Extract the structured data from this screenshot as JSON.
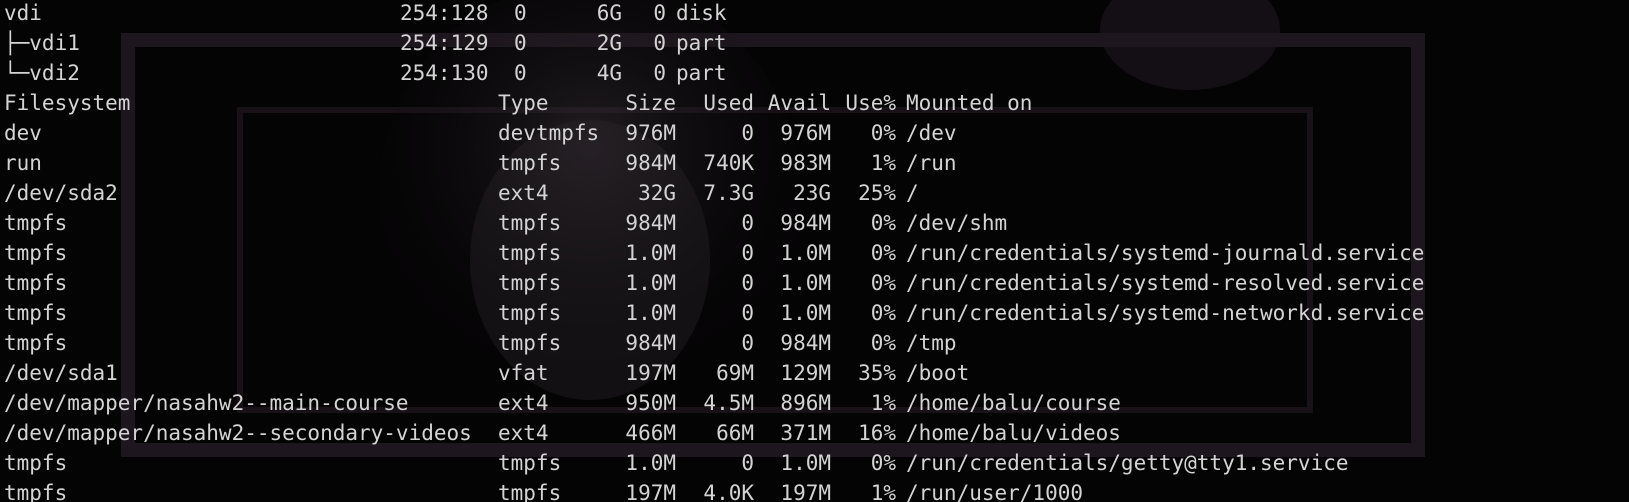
{
  "lsblk_rows": [
    {
      "name": "vdi",
      "majmin": "254:128",
      "rm": "0",
      "size": "6G",
      "ro": "0",
      "type": "disk"
    },
    {
      "name": "├─vdi1",
      "majmin": "254:129",
      "rm": "0",
      "size": "2G",
      "ro": "0",
      "type": "part"
    },
    {
      "name": "└─vdi2",
      "majmin": "254:130",
      "rm": "0",
      "size": "4G",
      "ro": "0",
      "type": "part"
    }
  ],
  "df_header": {
    "filesystem": "Filesystem",
    "type": "Type",
    "size": "Size",
    "used": "Used",
    "avail": "Avail",
    "use_pct": "Use%",
    "mounted_on": "Mounted on"
  },
  "df_rows": [
    {
      "filesystem": "dev",
      "type": "devtmpfs",
      "size": "976M",
      "used": "0",
      "avail": "976M",
      "use_pct": "0%",
      "mounted_on": "/dev"
    },
    {
      "filesystem": "run",
      "type": "tmpfs",
      "size": "984M",
      "used": "740K",
      "avail": "983M",
      "use_pct": "1%",
      "mounted_on": "/run"
    },
    {
      "filesystem": "/dev/sda2",
      "type": "ext4",
      "size": "32G",
      "used": "7.3G",
      "avail": "23G",
      "use_pct": "25%",
      "mounted_on": "/"
    },
    {
      "filesystem": "tmpfs",
      "type": "tmpfs",
      "size": "984M",
      "used": "0",
      "avail": "984M",
      "use_pct": "0%",
      "mounted_on": "/dev/shm"
    },
    {
      "filesystem": "tmpfs",
      "type": "tmpfs",
      "size": "1.0M",
      "used": "0",
      "avail": "1.0M",
      "use_pct": "0%",
      "mounted_on": "/run/credentials/systemd-journald.service"
    },
    {
      "filesystem": "tmpfs",
      "type": "tmpfs",
      "size": "1.0M",
      "used": "0",
      "avail": "1.0M",
      "use_pct": "0%",
      "mounted_on": "/run/credentials/systemd-resolved.service"
    },
    {
      "filesystem": "tmpfs",
      "type": "tmpfs",
      "size": "1.0M",
      "used": "0",
      "avail": "1.0M",
      "use_pct": "0%",
      "mounted_on": "/run/credentials/systemd-networkd.service"
    },
    {
      "filesystem": "tmpfs",
      "type": "tmpfs",
      "size": "984M",
      "used": "0",
      "avail": "984M",
      "use_pct": "0%",
      "mounted_on": "/tmp"
    },
    {
      "filesystem": "/dev/sda1",
      "type": "vfat",
      "size": "197M",
      "used": "69M",
      "avail": "129M",
      "use_pct": "35%",
      "mounted_on": "/boot"
    },
    {
      "filesystem": "/dev/mapper/nasahw2--main-course",
      "type": "ext4",
      "size": "950M",
      "used": "4.5M",
      "avail": "896M",
      "use_pct": "1%",
      "mounted_on": "/home/balu/course"
    },
    {
      "filesystem": "/dev/mapper/nasahw2--secondary-videos",
      "type": "ext4",
      "size": "466M",
      "used": "66M",
      "avail": "371M",
      "use_pct": "16%",
      "mounted_on": "/home/balu/videos"
    },
    {
      "filesystem": "tmpfs",
      "type": "tmpfs",
      "size": "1.0M",
      "used": "0",
      "avail": "1.0M",
      "use_pct": "0%",
      "mounted_on": "/run/credentials/getty@tty1.service"
    },
    {
      "filesystem": "tmpfs",
      "type": "tmpfs",
      "size": "197M",
      "used": "4.0K",
      "avail": "197M",
      "use_pct": "1%",
      "mounted_on": "/run/user/1000"
    }
  ],
  "colors": {
    "background": "#050405",
    "foreground": "#d4d4d4",
    "wallpaper_tint": "#2a1e2a"
  }
}
